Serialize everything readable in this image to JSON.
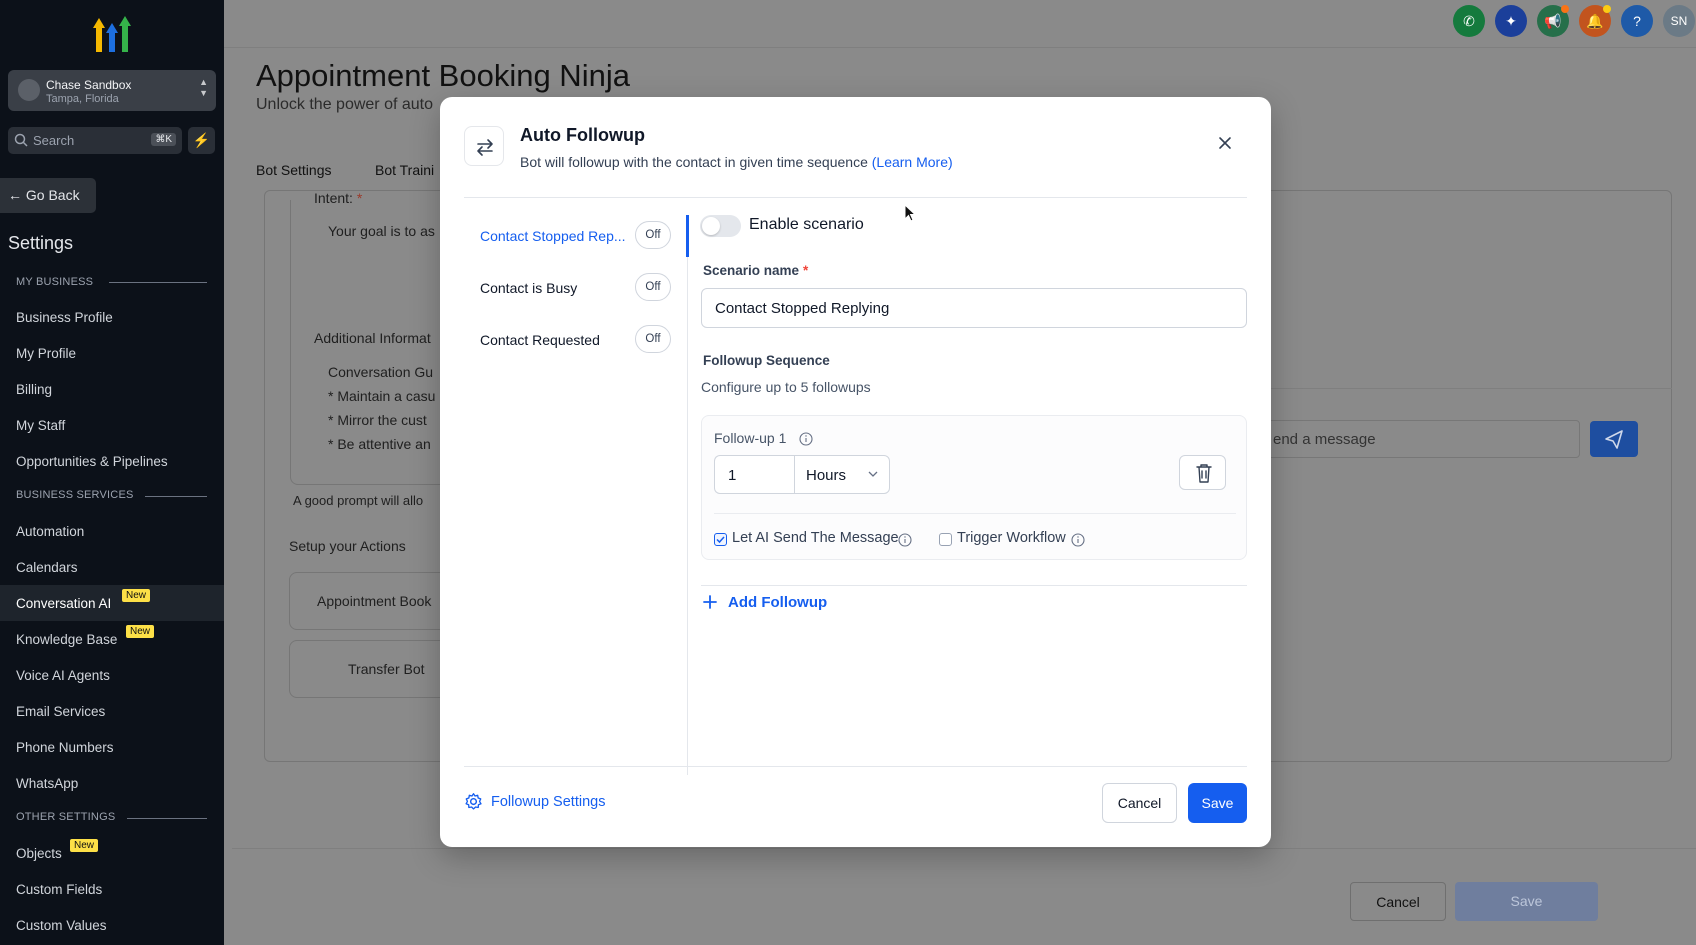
{
  "sidebar": {
    "account": {
      "name": "Chase Sandbox",
      "location": "Tampa, Florida"
    },
    "search": {
      "placeholder": "Search",
      "shortcut": "⌘K"
    },
    "go_back": "Go Back",
    "title": "Settings",
    "sections": {
      "my_business": "MY BUSINESS",
      "business_services": "BUSINESS SERVICES",
      "other_settings": "OTHER SETTINGS"
    },
    "items": [
      {
        "label": "Business Profile"
      },
      {
        "label": "My Profile"
      },
      {
        "label": "Billing"
      },
      {
        "label": "My Staff"
      },
      {
        "label": "Opportunities & Pipelines"
      },
      {
        "label": "Automation"
      },
      {
        "label": "Calendars"
      },
      {
        "label": "Conversation AI",
        "badge": "New",
        "active": true
      },
      {
        "label": "Knowledge Base",
        "badge": "New"
      },
      {
        "label": "Voice AI Agents"
      },
      {
        "label": "Email Services"
      },
      {
        "label": "Phone Numbers"
      },
      {
        "label": "WhatsApp"
      },
      {
        "label": "Objects",
        "badge": "New"
      },
      {
        "label": "Custom Fields"
      },
      {
        "label": "Custom Values"
      }
    ]
  },
  "topbar": {
    "avatar_initials": "SN",
    "help": "?"
  },
  "page": {
    "title": "Appointment Booking Ninja",
    "subtitle": "Unlock the power of auto",
    "tabs": [
      "Bot Settings",
      "Bot Traini"
    ],
    "intent_label": "Intent:",
    "intent_required": "*",
    "intent_text": "Your goal is to as",
    "additional_info_label": "Additional Informat",
    "guidelines": [
      "Conversation Gu",
      "* Maintain a casu",
      "* Mirror the cust",
      "* Be attentive an"
    ],
    "prompt_hint": "A good prompt will allo",
    "actions_label": "Setup your Actions",
    "actions": [
      "Appointment Book",
      "Transfer Bot"
    ],
    "message_placeholder": "end a message",
    "cancel": "Cancel",
    "save": "Save"
  },
  "modal": {
    "title": "Auto Followup",
    "description": "Bot will followup with the contact in given time sequence",
    "learn_more": "(Learn More)",
    "scenarios": [
      {
        "label": "Contact Stopped Rep...",
        "state": "Off",
        "active": true
      },
      {
        "label": "Contact is Busy",
        "state": "Off"
      },
      {
        "label": "Contact Requested",
        "state": "Off"
      }
    ],
    "enable_label": "Enable scenario",
    "scenario_name_label": "Scenario name",
    "required_mark": "*",
    "scenario_name_value": "Contact Stopped Replying",
    "sequence_label": "Followup Sequence",
    "sequence_help": "Configure up to 5 followups",
    "followups": [
      {
        "title": "Follow-up 1",
        "amount": "1",
        "unit": "Hours",
        "ai_send": true,
        "ai_send_label": "Let AI Send The Message",
        "trigger_workflow": false,
        "trigger_label": "Trigger Workflow"
      }
    ],
    "add_followup": "Add Followup",
    "settings_link": "Followup Settings",
    "cancel": "Cancel",
    "save": "Save"
  },
  "colors": {
    "primary": "#155eef",
    "sidebar_bg": "#0c1119",
    "badge": "#fde047"
  }
}
